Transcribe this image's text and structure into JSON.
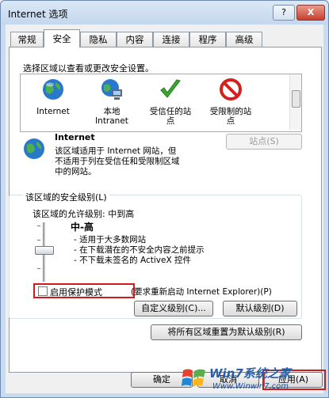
{
  "window": {
    "title": "Internet 选项",
    "help_label": "?",
    "close_label": "X"
  },
  "tabs": [
    "常规",
    "安全",
    "隐私",
    "内容",
    "连接",
    "程序",
    "高级"
  ],
  "security": {
    "instruction": "选择区域以查看或更改安全设置。",
    "zones": [
      {
        "label": "Internet",
        "icon": "globe-icon"
      },
      {
        "label": "本地\nIntranet",
        "icon": "local-intranet-icon"
      },
      {
        "label": "受信任的站\n点",
        "icon": "checkmark-icon"
      },
      {
        "label": "受限制的站\n点",
        "icon": "prohibited-icon"
      }
    ],
    "zone_title": "Internet",
    "zone_desc": "该区域适用于 Internet 网站，但\n不适用于列在受信任和受限制区域\n中的网站。",
    "sites_button": "站点(S)",
    "level_group": "该区域的安全级别(L)",
    "allowed_levels": "该区域的允许级别: 中到高",
    "level_name": "中-高",
    "bullets": [
      "- 适用于大多数网站",
      "- 在下载潜在的不安全内容之前提示",
      "- 不下载未签名的 ActiveX 控件"
    ],
    "protected_mode": "启用保护模式",
    "protected_mode_note": "(要求重新启动 Internet Explorer)(P)",
    "custom_level": "自定义级别(C)...",
    "default_level": "默认级别(D)",
    "reset_all": "将所有区域重置为默认级别(R)"
  },
  "footer": {
    "ok": "确定",
    "cancel": "取消",
    "apply": "应用(A)"
  },
  "watermark": {
    "brand": "Win7系统之家",
    "url": "Www.Winwin7.com"
  },
  "colors": {
    "highlight_box": "#d11a1a",
    "title_bg": "#c3d7ee"
  }
}
